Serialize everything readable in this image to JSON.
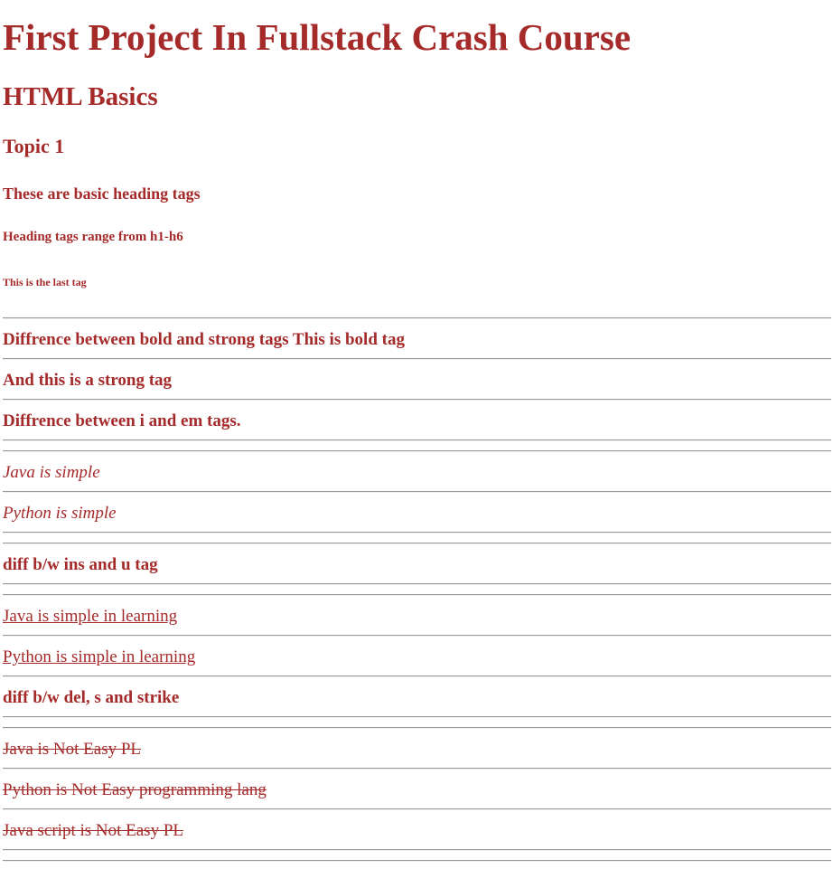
{
  "headings": {
    "h1": "First Project In Fullstack Crash Course",
    "h2": "HTML Basics",
    "h3": "Topic 1",
    "h4": "These are basic heading tags",
    "h5": "Heading tags range from h1-h6",
    "h6": "This is the last tag"
  },
  "bold_strong": {
    "line1": "Diffrence between bold and strong tags This is bold tag",
    "line2": "And this is a strong tag"
  },
  "italic_em": {
    "title": "Diffrence between i and em tags.",
    "item1": "Java is simple",
    "item2": "Python is simple"
  },
  "ins_u": {
    "title": "diff b/w ins and u tag",
    "item1": "Java is simple in learning",
    "item2": "Python is simple in learning"
  },
  "del_strike": {
    "title": "diff b/w del, s and strike",
    "item1": "Java is Not Easy PL",
    "item2": "Python is Not Easy programming lang",
    "item3": "Java script is Not Easy PL"
  },
  "colors": {
    "text": "#a52a2a",
    "rule": "#9a9a9a",
    "background": "#ffffff"
  }
}
